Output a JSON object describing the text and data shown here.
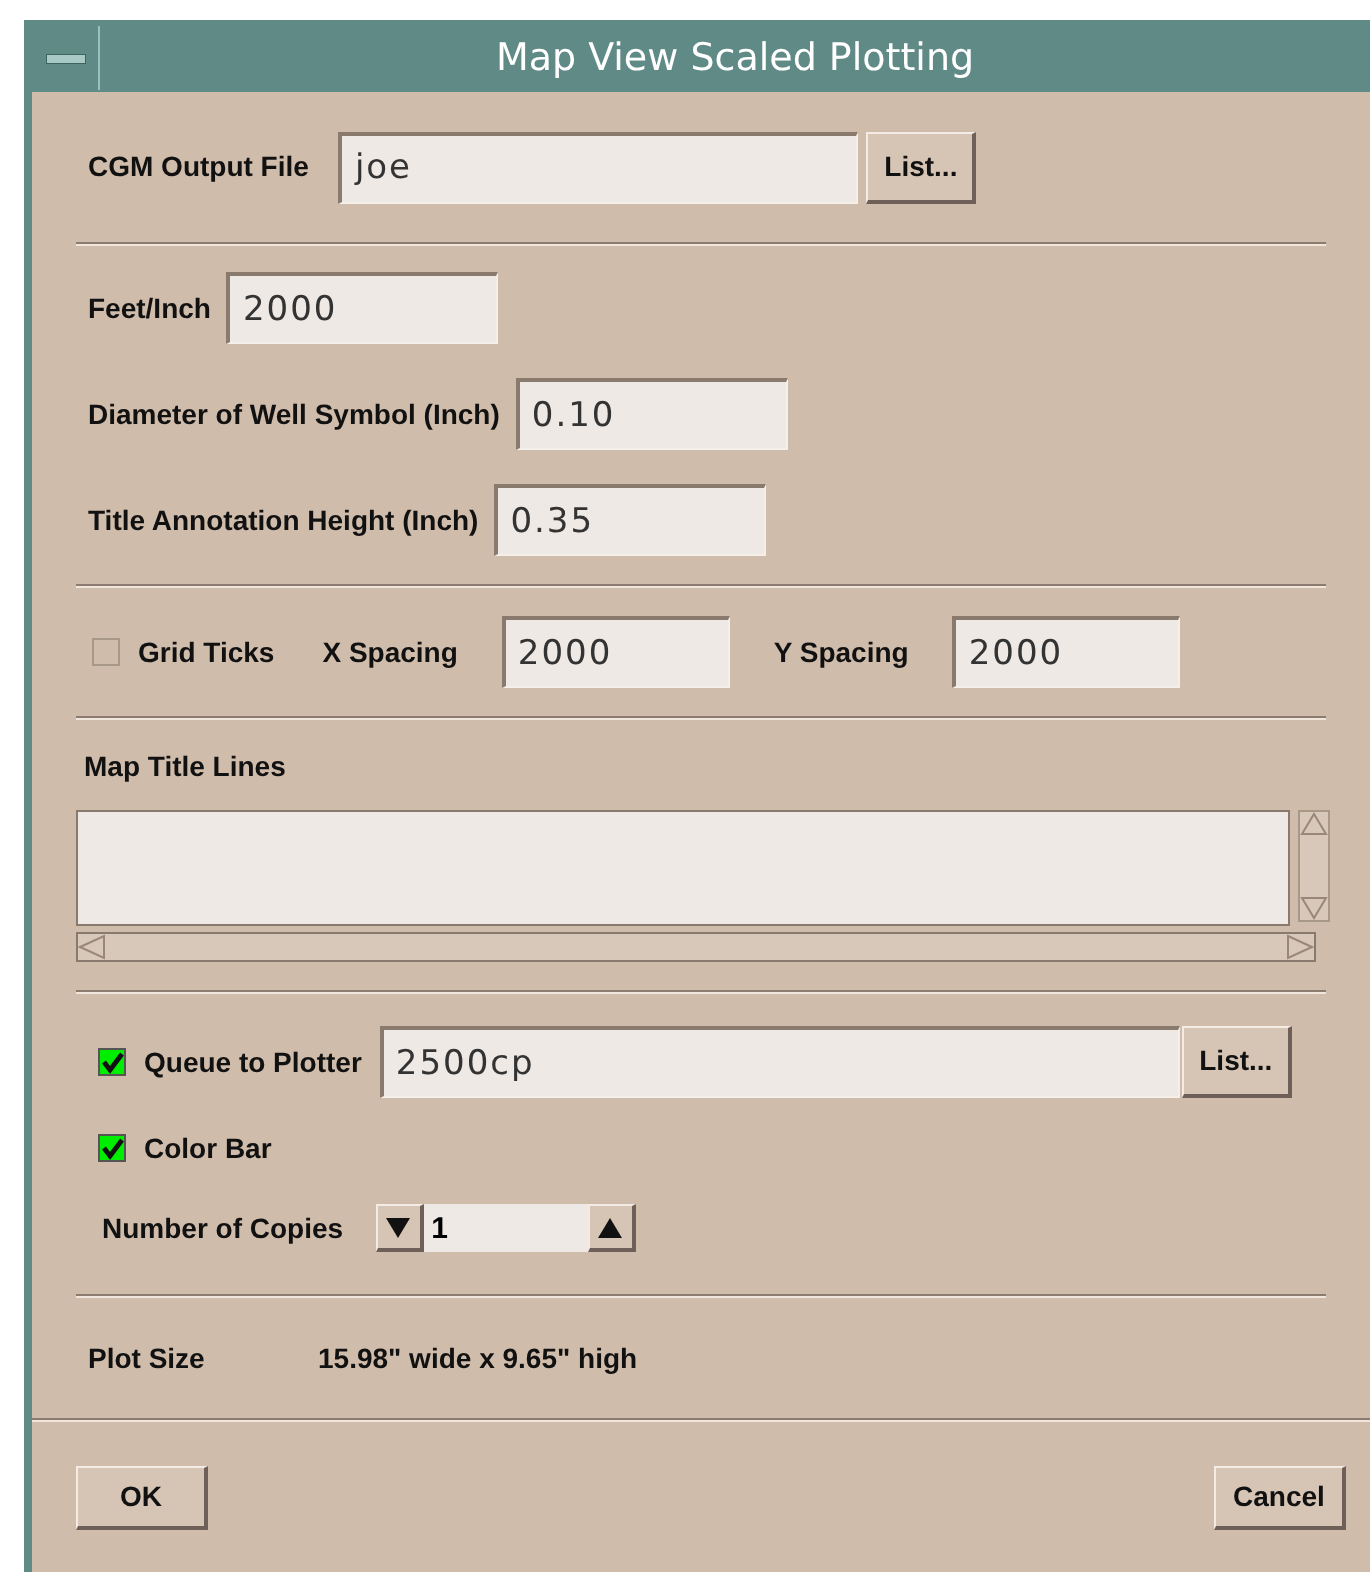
{
  "window": {
    "title": "Map View Scaled Plotting"
  },
  "output_file": {
    "label": "CGM Output File",
    "value": "joe",
    "button": "List..."
  },
  "scale": [
    {
      "label": "Feet/Inch",
      "value": "2000"
    },
    {
      "label": "Diameter of Well Symbol (Inch)",
      "value": "0.10"
    },
    {
      "label": "Title Annotation Height (Inch)",
      "value": "0.35"
    }
  ],
  "grid": {
    "label": "Grid Ticks",
    "checked": false,
    "x_label": "X Spacing",
    "x_value": "2000",
    "y_label": "Y Spacing",
    "y_value": "2000"
  },
  "map_title": {
    "label": "Map Title Lines"
  },
  "queue": {
    "label": "Queue to Plotter",
    "checked": true,
    "value": "2500cp",
    "button": "List..."
  },
  "color_bar": {
    "label": "Color Bar",
    "checked": true
  },
  "copies": {
    "label": "Number of Copies",
    "value": "1"
  },
  "plot_size": {
    "label": "Plot Size",
    "value": "15.98\" wide x 9.65\" high"
  },
  "buttons": {
    "ok": "OK",
    "cancel": "Cancel"
  }
}
